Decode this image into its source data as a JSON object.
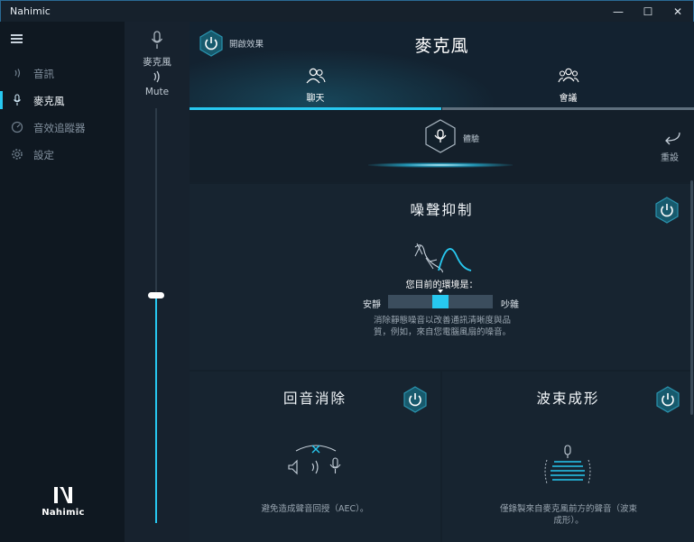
{
  "window": {
    "title": "Nahimic",
    "minimize_icon": "—",
    "maximize_icon": "☐",
    "close_icon": "✕"
  },
  "sidebar": {
    "items": [
      {
        "label": "音訊",
        "icon": "speaker-wave-icon",
        "glyph": "◖)"
      },
      {
        "label": "麥克風",
        "icon": "microphone-icon",
        "glyph": "🎙"
      },
      {
        "label": "音效追蹤器",
        "icon": "tracker-icon",
        "glyph": "◔"
      },
      {
        "label": "設定",
        "icon": "gear-icon",
        "glyph": "⚙"
      }
    ],
    "active_index": 1,
    "logo_text": "Nahimic"
  },
  "volume": {
    "device_label": "麥克風",
    "mute_label": "Mute",
    "level": 0.45
  },
  "header": {
    "enable_label": "開啟效果",
    "title": "麥克風",
    "tabs": [
      {
        "label": "聊天",
        "icon": "users-icon"
      },
      {
        "label": "會議",
        "icon": "group-icon"
      }
    ],
    "active_tab": 0
  },
  "profile": {
    "label": "體驗",
    "reset_label": "重設"
  },
  "noise": {
    "title": "噪聲抑制",
    "env_title": "您目前的環境是：",
    "env_low": "安靜",
    "env_high": "吵雜",
    "env_level": 0.5,
    "description_line1": "消除靜態噪音以改善通訊清晰度與品",
    "description_line2": "質，例如，來自您電腦風扇的噪音。"
  },
  "echo": {
    "title": "回音消除",
    "description": "避免造成聲音回授（AEC）。"
  },
  "beam": {
    "title": "波束成形",
    "description_line1": "僅錄製來自麥克風前方的聲音（波束",
    "description_line2": "成形）。"
  },
  "colors": {
    "accent": "#27c8f0",
    "panel": "#172430",
    "background": "#14202b"
  }
}
